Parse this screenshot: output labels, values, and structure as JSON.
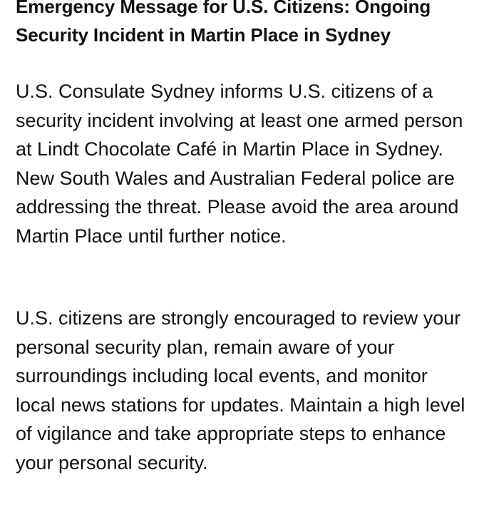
{
  "message": {
    "title": "Emergency Message for U.S. Citizens: Ongoing Security Incident in Martin Place in Sydney",
    "paragraphs": [
      "U.S. Consulate Sydney informs U.S. citizens of a security incident involving at least one armed person at Lindt Chocolate Café in Martin Place in Sydney.  New South Wales and Australian Federal police are addressing the threat.  Please avoid the area around Martin Place until further notice.",
      "U.S. citizens are strongly encouraged to review your personal security plan, remain aware of your surroundings including local events, and monitor local news stations for updates. Maintain a high level of vigilance and take appropriate steps to enhance your personal security."
    ]
  }
}
